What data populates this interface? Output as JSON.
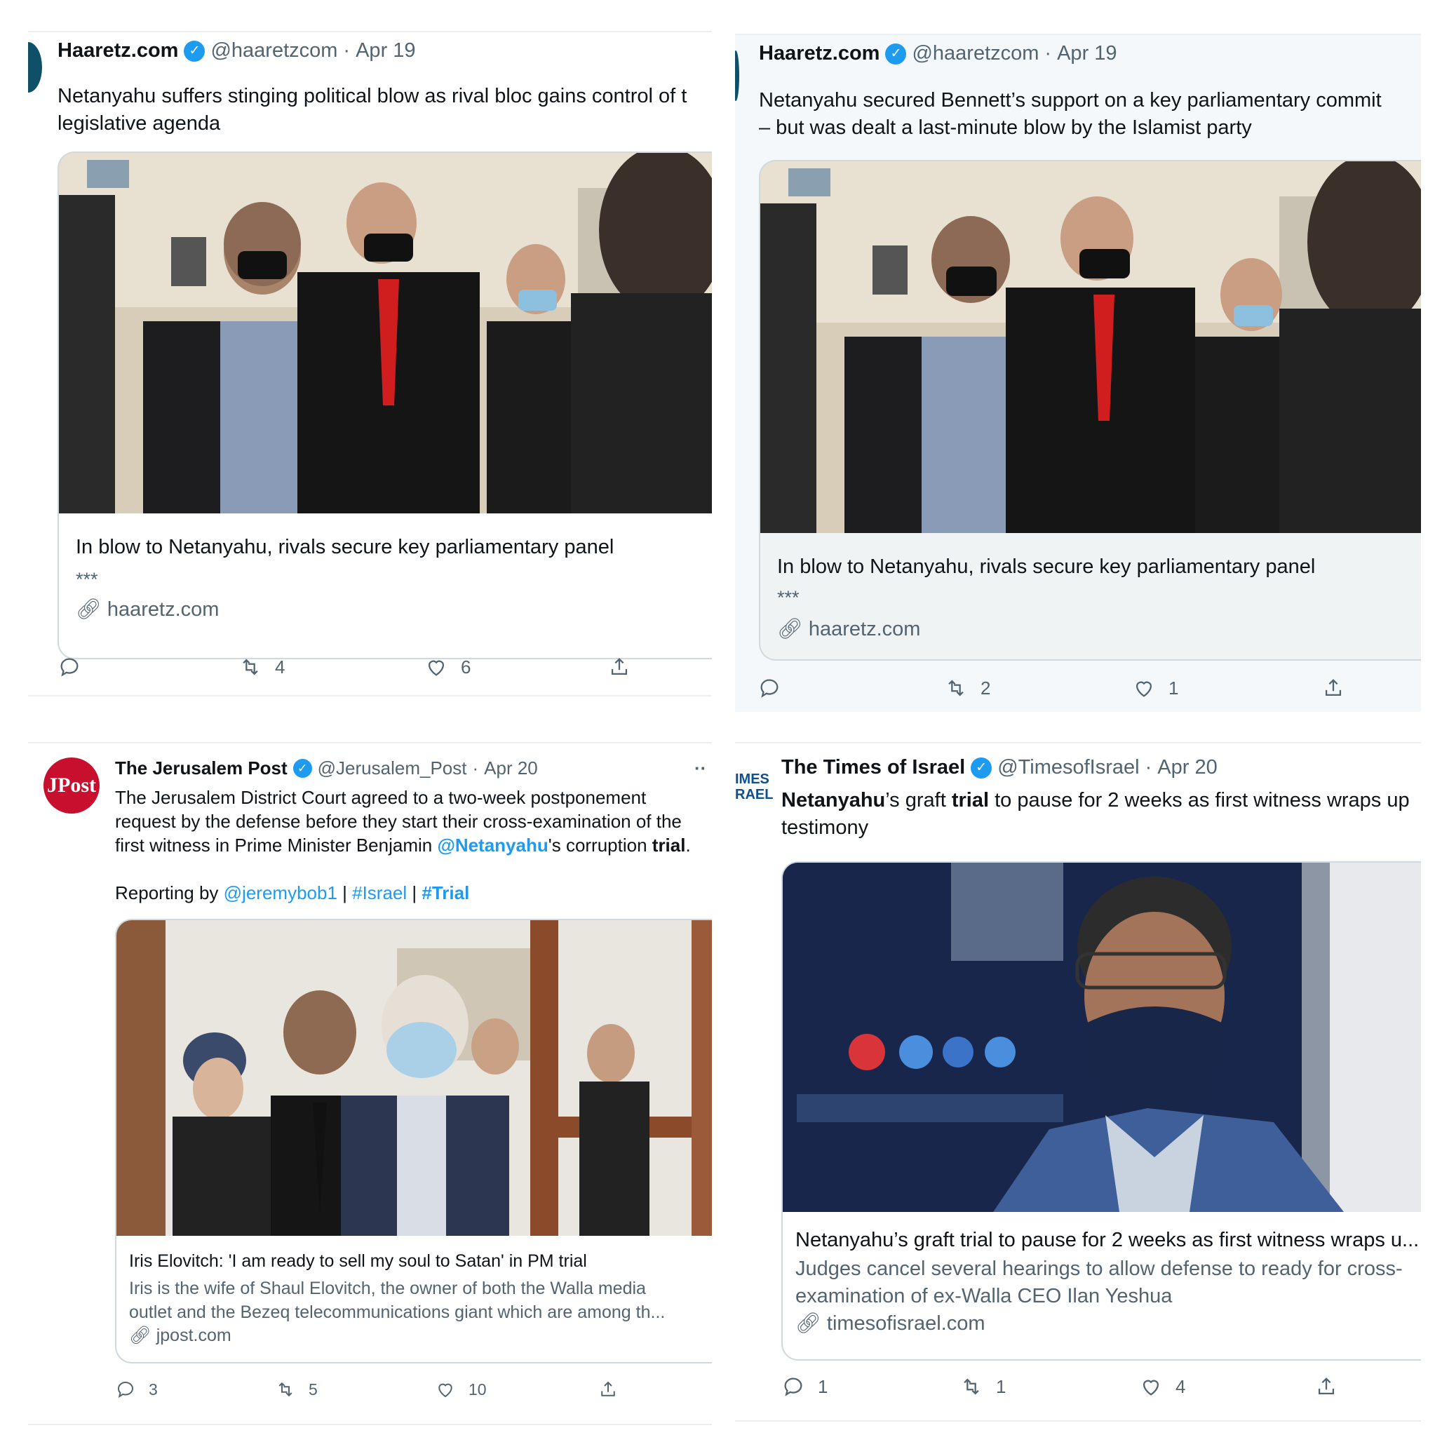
{
  "tweets": [
    {
      "account": "Haaretz.com",
      "handle": "@haaretzcom",
      "date": "Apr 19",
      "text_line1": "Netanyahu suffers stinging political blow as rival bloc gains control of t",
      "text_line2": "legislative agenda",
      "card_title": "In blow to Netanyahu, rivals secure key parliamentary panel",
      "card_sub": "***",
      "card_domain": "haaretz.com",
      "replies": "",
      "retweets": "4",
      "likes": "6"
    },
    {
      "account": "Haaretz.com",
      "handle": "@haaretzcom",
      "date": "Apr 19",
      "text_line1": "Netanyahu secured Bennett’s support on a key parliamentary commit",
      "text_line2": "– but was dealt a last-minute blow by the Islamist party",
      "card_title": "In blow to Netanyahu, rivals secure key parliamentary panel",
      "card_sub": "***",
      "card_domain": "haaretz.com",
      "replies": "",
      "retweets": "2",
      "likes": "1"
    },
    {
      "account": "The Jerusalem Post",
      "handle": "@Jerusalem_Post",
      "date": "Apr 20",
      "avatar_text": "JPost",
      "more": "··",
      "text_line1": "The Jerusalem District Court agreed to a two-week postponement",
      "text_line2": "request by the defense before they start their cross-examination of the",
      "text_line3_a": "first witness in Prime Minister Benjamin ",
      "text_line3_mention": "@Netanyahu",
      "text_line3_b": "'s corruption ",
      "text_line3_bold": "trial",
      "text_line3_end": ".",
      "reporting_label": "Reporting by ",
      "reporting_mention": "@jeremybob1",
      "sep1": " | ",
      "hashtag1": "#Israel",
      "sep2": " | ",
      "hashtag2": "#Trial",
      "card_title": "Iris Elovitch: 'I am ready to sell my soul to Satan' in PM trial",
      "card_sub_line1": "Iris is the wife of Shaul Elovitch, the owner of both the Walla media",
      "card_sub_line2": "outlet and the Bezeq telecommunications giant which are among th...",
      "card_domain": "jpost.com",
      "replies": "3",
      "retweets": "5",
      "likes": "10"
    },
    {
      "account": "The Times of Israel",
      "handle": "@TimesofIsrael",
      "date": "Apr 20",
      "avatar_text_1": "IMES",
      "avatar_text_2": "RAEL",
      "text_a": "Netanyahu",
      "text_b": "’s graft ",
      "text_c": "trial",
      "text_d": " to pause for 2 weeks as first witness wraps up",
      "text_line2": "testimony",
      "card_title": "Netanyahu’s graft trial to pause for 2 weeks as first witness wraps u...",
      "card_sub_line1": "Judges cancel several hearings to allow defense to ready for cross-",
      "card_sub_line2": "examination of ex-Walla CEO Ilan Yeshua",
      "card_domain": "timesofisrael.com",
      "replies": "1",
      "retweets": "1",
      "likes": "4"
    }
  ],
  "colors": {
    "link_blue": "#1d9bf0",
    "verified_blue": "#1d9bf0",
    "secondary_text": "#536471",
    "jpost_red": "#c8102e",
    "haaretz_teal": "#0f4f67"
  },
  "icons": [
    "reply-icon",
    "retweet-icon",
    "like-icon",
    "share-icon",
    "link-icon",
    "verified-icon"
  ]
}
